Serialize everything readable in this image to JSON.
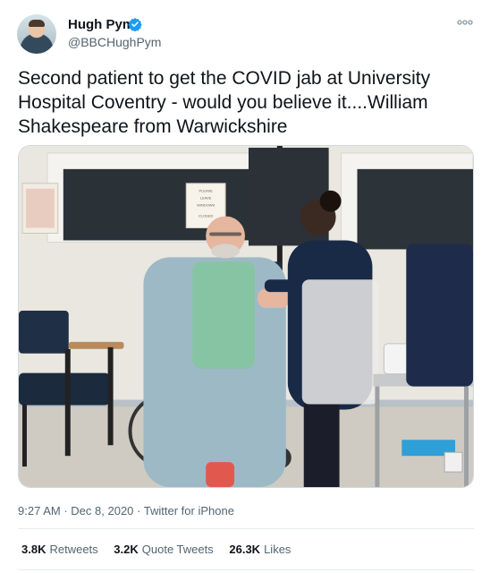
{
  "author": {
    "display_name": "Hugh Pym",
    "handle": "@BBCHughPym",
    "verified": true,
    "verified_color": "#1d9bf0"
  },
  "tweet": {
    "text": "Second patient to get the COVID jab at University Hospital Coventry - would you believe it....William Shakespeare from Warwickshire",
    "time": "9:27 AM",
    "date": "Dec 8, 2020",
    "source": "Twitter for iPhone",
    "separator": "·"
  },
  "photo": {
    "sign_text": [
      "PLEASE",
      "LEAVE",
      "WINDOWS",
      "CLOSED"
    ]
  },
  "stats": {
    "retweets_count": "3.8K",
    "retweets_label": "Retweets",
    "quotes_count": "3.2K",
    "quotes_label": "Quote Tweets",
    "likes_count": "26.3K",
    "likes_label": "Likes"
  },
  "icons": {
    "avatar": "avatar",
    "verified": "verified-badge-icon",
    "more": "more-options-icon"
  }
}
